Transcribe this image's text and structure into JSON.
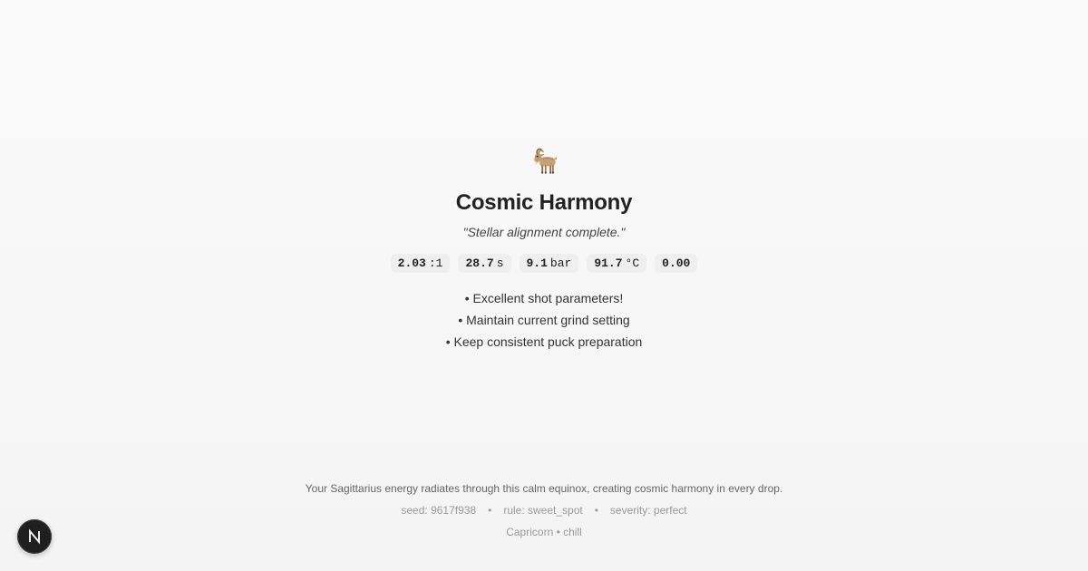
{
  "zodiac_icon": "goat-icon",
  "title": "Cosmic Harmony",
  "quote": "\"Stellar alignment complete.\"",
  "metrics": [
    {
      "value": "2.03",
      "unit": ":1"
    },
    {
      "value": "28.7",
      "unit": "s"
    },
    {
      "value": "9.1",
      "unit": "bar"
    },
    {
      "value": "91.7",
      "unit": "°C"
    },
    {
      "value": "0.00",
      "unit": ""
    }
  ],
  "tips": [
    "• Excellent shot parameters!",
    "• Maintain current grind setting",
    "• Keep consistent puck preparation"
  ],
  "footer": {
    "story": "Your Sagittarius energy radiates through this calm equinox, creating cosmic harmony in every drop.",
    "seed": "seed: 9617f938",
    "rule": "rule: sweet_spot",
    "severity": "severity: perfect",
    "separator": "•",
    "sign": "Capricorn • chill"
  },
  "badge": {
    "letter": "N",
    "icon": "nextjs-logo-icon"
  },
  "colors": {
    "background": "#fafafa",
    "metric_chip": "#efefef",
    "badge": "#1f1f1f"
  }
}
